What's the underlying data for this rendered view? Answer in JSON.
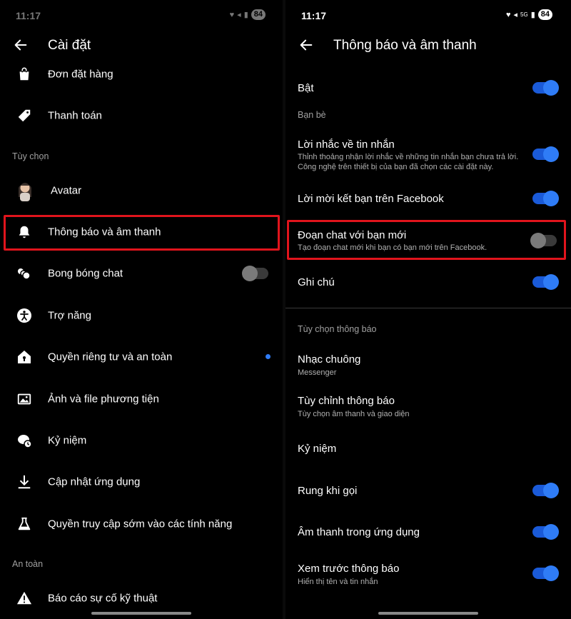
{
  "left": {
    "status": {
      "time": "11:17",
      "battery": "84"
    },
    "header": {
      "title": "Cài đặt"
    },
    "items_top": [
      {
        "label": "Đơn đặt hàng",
        "icon": "shopping-bag-icon"
      },
      {
        "label": "Thanh toán",
        "icon": "tag-icon"
      }
    ],
    "section_options": "Tùy chọn",
    "items": [
      {
        "label": "Avatar",
        "icon": "avatar-icon"
      },
      {
        "label": "Thông báo và âm thanh",
        "icon": "bell-icon"
      },
      {
        "label": "Bong bóng chat",
        "icon": "chat-bubbles-icon",
        "toggle": "off"
      },
      {
        "label": "Trợ năng",
        "icon": "accessibility-icon"
      },
      {
        "label": "Quyền riêng tư và an toàn",
        "icon": "privacy-house-icon",
        "badge_color": "#2f7cf6"
      },
      {
        "label": "Ảnh và file phương tiện",
        "icon": "image-icon"
      },
      {
        "label": "Kỷ niệm",
        "icon": "memories-clock-icon"
      },
      {
        "label": "Cập nhật ứng dụng",
        "icon": "download-icon"
      },
      {
        "label": "Quyền truy cập sớm vào các tính năng",
        "icon": "flask-icon"
      }
    ],
    "section_safety": "An toàn",
    "items_bottom": [
      {
        "label": "Báo cáo sự cố kỹ thuật",
        "icon": "warning-icon"
      }
    ]
  },
  "right": {
    "status": {
      "time": "11:17",
      "battery": "84",
      "network": "5G"
    },
    "header": {
      "title": "Thông báo và âm thanh"
    },
    "on": {
      "title": "Bật",
      "toggle": "on"
    },
    "section_friends": "Bạn bè",
    "message_reminders": {
      "title": "Lời nhắc về tin nhắn",
      "subtitle": "Thỉnh thoảng nhận lời nhắc về những tin nhắn bạn chưa trả lời. Công nghệ trên thiết bị của bạn đã chọn các cài đặt này.",
      "toggle": "on"
    },
    "facebook_invites": {
      "title": "Lời mời kết bạn trên Facebook",
      "toggle": "on"
    },
    "new_friend_chats": {
      "title": "Đoạn chat với bạn mới",
      "subtitle": "Tạo đoạn chat mới khi bạn có bạn mới trên Facebook.",
      "toggle": "off"
    },
    "notes": {
      "title": "Ghi chú",
      "toggle": "on"
    },
    "section_notification_options": "Tùy chọn thông báo",
    "ringtone": {
      "title": "Nhạc chuông",
      "subtitle": "Messenger"
    },
    "customize": {
      "title": "Tùy chỉnh thông báo",
      "subtitle": "Tùy chọn âm thanh và giao diện"
    },
    "memories": {
      "title": "Kỷ niệm"
    },
    "vibrate": {
      "title": "Rung khi gọi",
      "toggle": "on"
    },
    "in_app_sounds": {
      "title": "Âm thanh trong ứng dụng",
      "toggle": "on"
    },
    "preview": {
      "title": "Xem trước thông báo",
      "subtitle": "Hiển thị tên và tin nhắn",
      "toggle": "on"
    }
  },
  "colors": {
    "accent": "#2f7cf6",
    "highlight": "#e1141c",
    "background": "#000000"
  }
}
